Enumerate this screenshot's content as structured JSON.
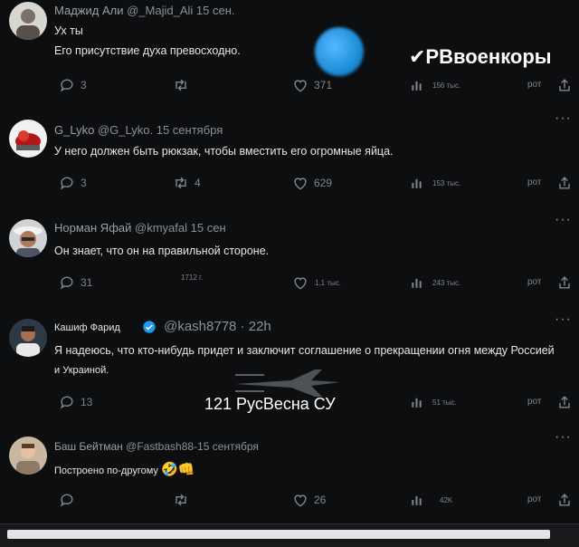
{
  "colors": {
    "background": "#0b0b0d",
    "text": "#e6e6e6",
    "muted": "#80868b",
    "verified": "#1d9bf0"
  },
  "tweets": [
    {
      "name": "Маджид Али",
      "handle": "@_Majid_Ali",
      "date": "15 сен.",
      "text": "Ух ты\nЕго присутствие духа превосходно.",
      "replies": "3",
      "retweets": "",
      "likes": "371",
      "views": "156 тыс.",
      "extra": "рот"
    },
    {
      "name": "G_Lyko",
      "handle": "@G_Lyko.",
      "date": "15 сентября",
      "text": "У него должен быть рюкзак, чтобы вместить его огромные яйца.",
      "replies": "3",
      "retweets": "4",
      "likes": "629",
      "views": "153 тыс.",
      "extra": "рот"
    },
    {
      "name": "Норман Яфай",
      "handle": "@kmyafal",
      "date": "15 сен",
      "text": "Он знает, что он на правильной стороне.",
      "replies": "31",
      "retweets": "1712 г.",
      "likes": "1,1 тыс.",
      "views": "243 тыс.",
      "extra": "рот"
    },
    {
      "name": "Кашиф Фарид",
      "handle": "@kash8778 · 22h",
      "date": "",
      "text": "Я надеюсь, что кто-нибудь придет и заключит соглашение о прекращении огня между Россией\nи Украиной.",
      "replies": "13",
      "retweets": "",
      "likes": "",
      "views": "51 тыс.",
      "extra": "рот"
    },
    {
      "name": "Баш Бейтман",
      "handle": "@Fastbash88",
      "date": "-15 сентября",
      "text": "Построено по-другому",
      "replies": "",
      "retweets": "",
      "likes": "26",
      "views": "42K",
      "extra": "рот"
    }
  ],
  "watermarks": {
    "top": "✔РВвоенкоры",
    "middle": "121 РусВесна СУ"
  },
  "icons": [
    "reply-icon",
    "retweet-icon",
    "like-icon",
    "views-icon",
    "share-icon",
    "more-icon",
    "verified-icon"
  ]
}
